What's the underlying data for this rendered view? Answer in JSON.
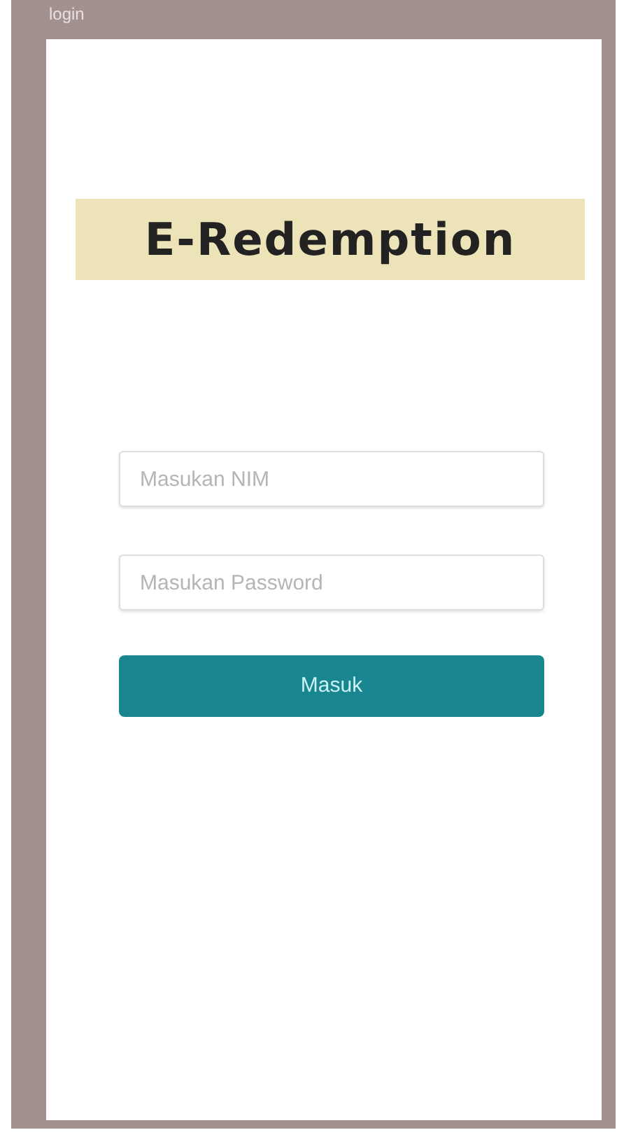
{
  "window": {
    "title": "login"
  },
  "banner": {
    "title": "E-Redemption"
  },
  "form": {
    "fields": [
      {
        "placeholder": "Masukan NIM",
        "kind": "text"
      },
      {
        "placeholder": "Masukan Password",
        "kind": "password"
      }
    ],
    "submit": "Masuk"
  }
}
